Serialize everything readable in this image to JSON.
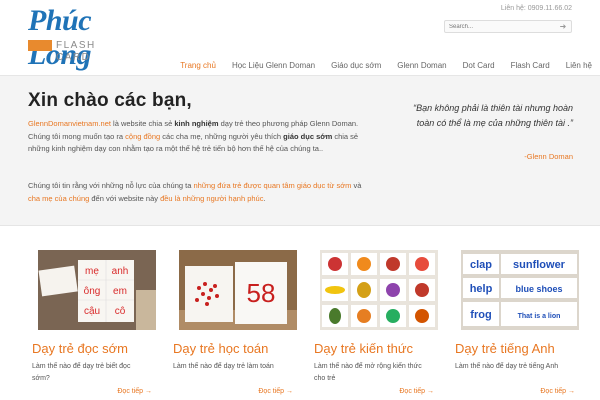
{
  "logo": {
    "main": "Phúc Long",
    "sub": "FLASH CARD"
  },
  "header": {
    "contact": "Liên hệ: 0909.11.66.02"
  },
  "search": {
    "placeholder": "Search..."
  },
  "nav": {
    "items": [
      {
        "label": "Trang chủ",
        "active": true
      },
      {
        "label": "Học Liệu Glenn Doman",
        "active": false
      },
      {
        "label": "Giáo dục sớm",
        "active": false
      },
      {
        "label": "Glenn Doman",
        "active": false
      },
      {
        "label": "Dot Card",
        "active": false
      },
      {
        "label": "Flash Card",
        "active": false
      },
      {
        "label": "Liên hệ",
        "active": false
      }
    ]
  },
  "intro": {
    "title": "Xin chào các bạn,",
    "p1": {
      "site": "GlennDomanvietnam.net",
      "t1": " là website chia sẻ ",
      "b1": "kinh nghiệm",
      "t2": " dạy trẻ theo phương pháp Glenn Doman. Chúng tôi mong muốn tạo ra ",
      "l1": "cộng đồng",
      "t3": " các cha mẹ, những người yêu thích ",
      "b2": "giáo dục sớm",
      "t4": " chia sẻ những kinh nghiệm dạy con nhằm tạo ra một thế hệ trẻ tiến bộ hơn thế hệ của chúng ta.."
    },
    "p2": {
      "t1": "Chúng tôi tin rằng với những nỗ lực của chúng ta ",
      "l1": "những đứa trẻ được quan tâm giáo dục từ sớm",
      "t2": " và ",
      "l2": "cha mẹ của chúng",
      "t3": " đến với website này ",
      "l3": "đều là những người hạnh phúc",
      "t4": "."
    }
  },
  "quote": {
    "text": "“Bạn không phải là thiên tài nhưng hoàn toàn có thể là mẹ của những thiên tài .”",
    "author": "-Glenn Doman"
  },
  "cards": [
    {
      "title": "Dạy trẻ đọc sớm",
      "desc": "Làm thế nào để dạy trẻ biết đọc sớm?",
      "more": "Đọc tiếp →",
      "img_words": [
        "mẹ",
        "anh",
        "ông",
        "em",
        "cậu",
        "cô"
      ]
    },
    {
      "title": "Dạy trẻ học toán",
      "desc": "Làm thế nào để dạy trẻ làm toán",
      "more": "Đọc tiếp →",
      "img_number": "58"
    },
    {
      "title": "Dạy trẻ kiến thức",
      "desc": "Làm thế nào để mở rộng kiến thức cho trẻ",
      "more": "Đọc tiếp →"
    },
    {
      "title": "Dạy trẻ tiếng Anh",
      "desc": "Làm thế nào để dạy trẻ tiếng Anh",
      "more": "Đọc tiếp →",
      "img_words": [
        "clap",
        "sunflower",
        "help",
        "blue shoes",
        "frog",
        "That is a lion"
      ]
    }
  ],
  "colors": {
    "accent": "#e87722",
    "brand_blue": "#1f73b7",
    "band_bg": "#f4f4f4"
  }
}
